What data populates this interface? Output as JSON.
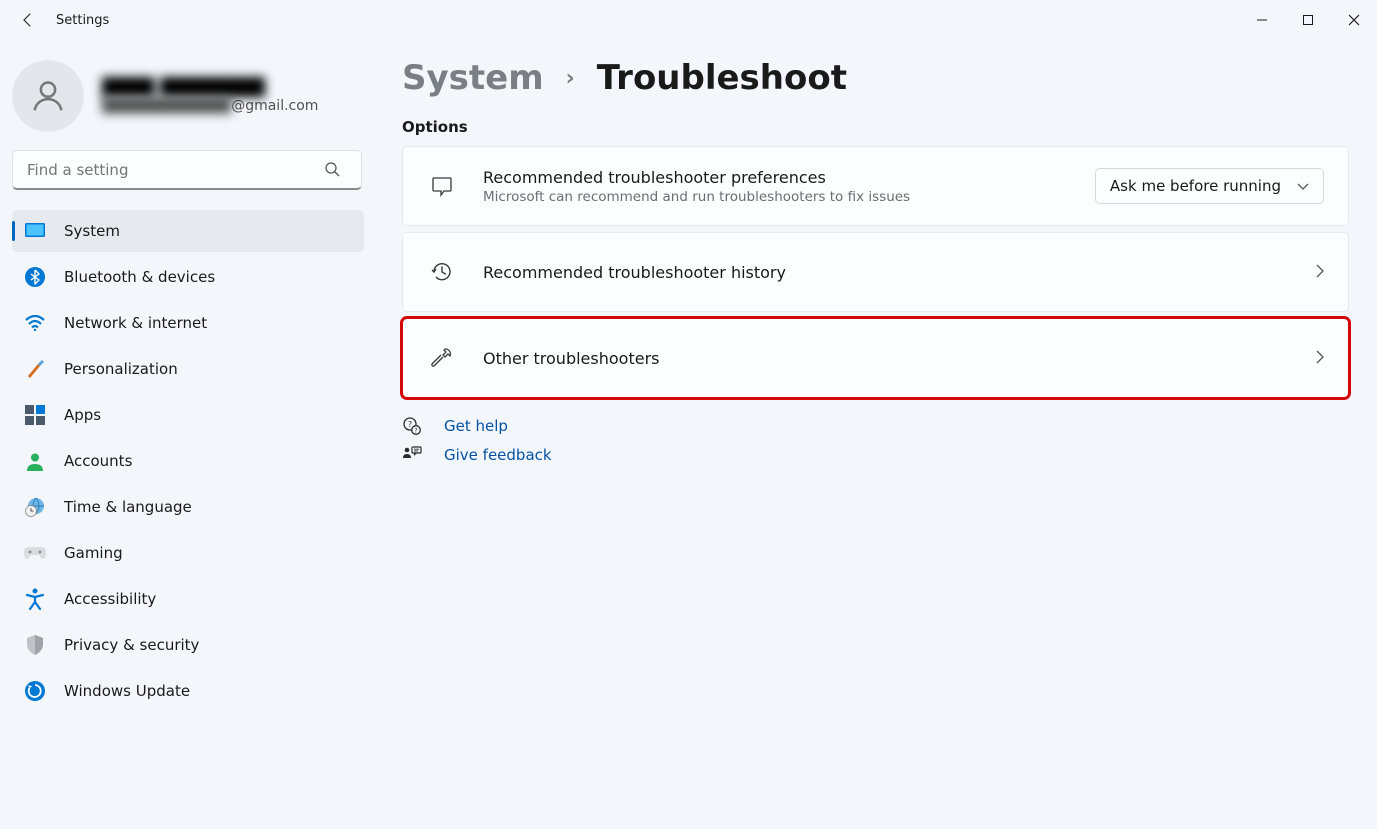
{
  "window": {
    "title": "Settings"
  },
  "account": {
    "name": "████ ████████",
    "email_prefix": "████████████",
    "email_suffix": "@gmail.com"
  },
  "search": {
    "placeholder": "Find a setting"
  },
  "nav": [
    {
      "label": "System",
      "active": true
    },
    {
      "label": "Bluetooth & devices"
    },
    {
      "label": "Network & internet"
    },
    {
      "label": "Personalization"
    },
    {
      "label": "Apps"
    },
    {
      "label": "Accounts"
    },
    {
      "label": "Time & language"
    },
    {
      "label": "Gaming"
    },
    {
      "label": "Accessibility"
    },
    {
      "label": "Privacy & security"
    },
    {
      "label": "Windows Update"
    }
  ],
  "breadcrumb": {
    "parent": "System",
    "child": "Troubleshoot"
  },
  "section": {
    "heading": "Options"
  },
  "cards": {
    "pref": {
      "title": "Recommended troubleshooter preferences",
      "subtitle": "Microsoft can recommend and run troubleshooters to fix issues",
      "dropdown_value": "Ask me before running"
    },
    "history": {
      "title": "Recommended troubleshooter history"
    },
    "other": {
      "title": "Other troubleshooters"
    }
  },
  "help": {
    "get_help": "Get help",
    "feedback": "Give feedback"
  }
}
